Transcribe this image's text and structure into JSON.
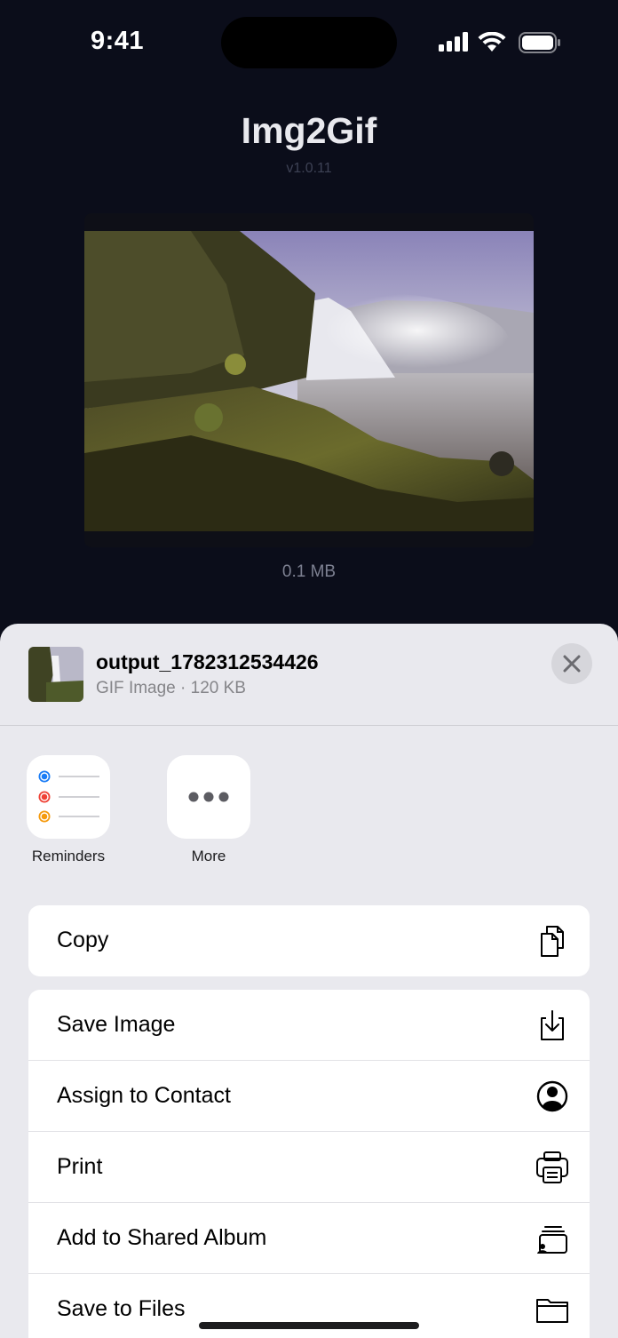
{
  "status_bar": {
    "time": "9:41"
  },
  "app": {
    "title": "Img2Gif",
    "version": "v1.0.11",
    "file_size": "0.1 MB"
  },
  "share_sheet": {
    "file_name": "output_1782312534426",
    "file_meta": "GIF Image · 120 KB",
    "apps": [
      {
        "label": "Reminders",
        "icon": "reminders-icon"
      },
      {
        "label": "More",
        "icon": "more-icon"
      }
    ],
    "actions_primary": [
      {
        "label": "Copy",
        "icon": "copy-icon"
      }
    ],
    "actions": [
      {
        "label": "Save Image",
        "icon": "save-image-icon"
      },
      {
        "label": "Assign to Contact",
        "icon": "contact-icon"
      },
      {
        "label": "Print",
        "icon": "printer-icon"
      },
      {
        "label": "Add to Shared Album",
        "icon": "shared-album-icon"
      },
      {
        "label": "Save to Files",
        "icon": "folder-icon"
      }
    ]
  },
  "colors": {
    "background": "#0b0d1a",
    "sheet": "#e9e9ee",
    "reminder_blue": "#1a7cf5",
    "reminder_red": "#ef4135",
    "reminder_orange": "#f59a0d"
  }
}
